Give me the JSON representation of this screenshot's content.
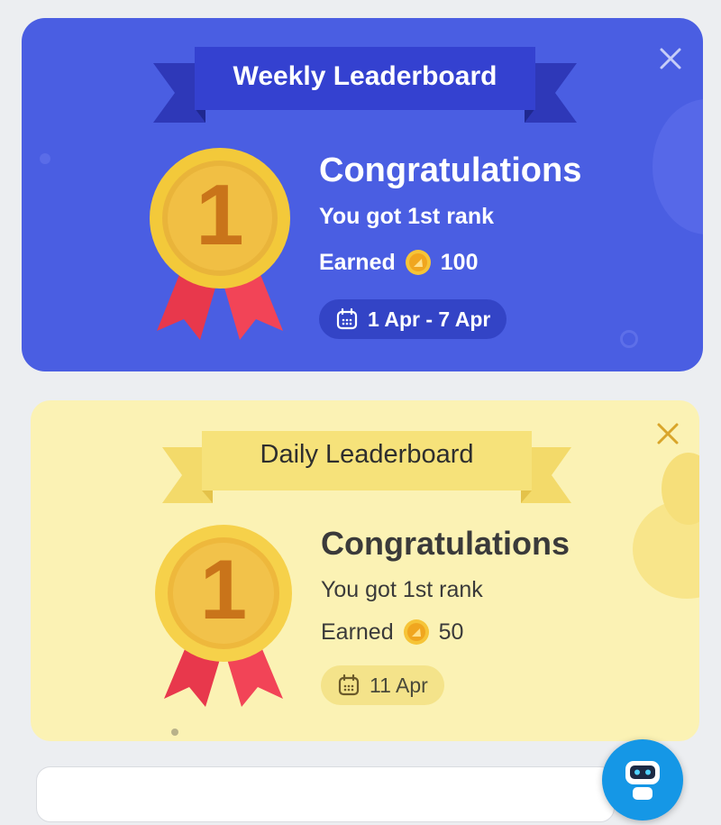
{
  "weekly": {
    "banner_title": "Weekly Leaderboard",
    "rank_number": "1",
    "heading": "Congratulations",
    "rank_text": "You got 1st rank",
    "earned_label": "Earned",
    "earned_points": "100",
    "date_range": "1 Apr - 7 Apr",
    "close_icon": "close-icon",
    "colors": {
      "background": "#4a5ee2",
      "banner": "#3441d0",
      "text": "#ffffff",
      "pill": "#3344c6"
    }
  },
  "daily": {
    "banner_title": "Daily Leaderboard",
    "rank_number": "1",
    "heading": "Congratulations",
    "rank_text": "You got 1st rank",
    "earned_label": "Earned",
    "earned_points": "50",
    "date": "11 Apr",
    "close_icon": "close-icon",
    "colors": {
      "background": "#fbf2b4",
      "banner": "#f6e27a",
      "text": "#3a3a3a",
      "pill": "#f4e38a",
      "close": "#d9a52a"
    }
  },
  "icons": {
    "medal": "gold-medal-icon",
    "coin": "coin-icon",
    "calendar": "calendar-icon",
    "assistant": "robot-assistant-icon"
  }
}
